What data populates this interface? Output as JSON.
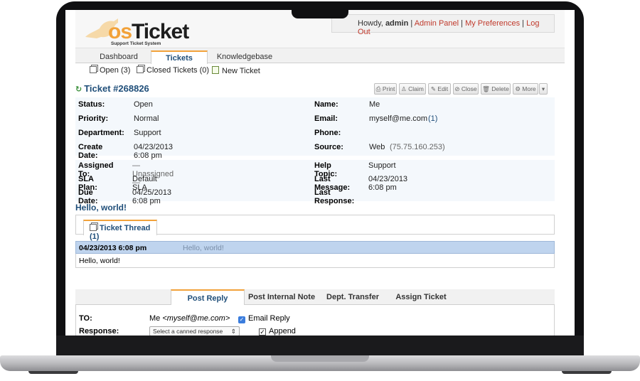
{
  "user_bar": {
    "greeting": "Howdy,",
    "username": "admin",
    "sep": "|",
    "admin_panel": "Admin Panel",
    "preferences": "My Preferences",
    "logout": "Log Out"
  },
  "logo": {
    "os": "os",
    "ticket": "Ticket",
    "subtitle": "Support Ticket System",
    "colors": {
      "accent": "#f2a23a",
      "text": "#1e1e1e"
    }
  },
  "nav": {
    "tabs": [
      {
        "label": "Dashboard"
      },
      {
        "label": "Tickets"
      },
      {
        "label": "Knowledgebase"
      }
    ],
    "active": "Tickets"
  },
  "subnav": {
    "open": "Open (3)",
    "closed": "Closed Tickets (0)",
    "new_ticket": "New Ticket"
  },
  "ticket": {
    "title": "Ticket #268826",
    "actions": [
      "Print",
      "Claim",
      "Edit",
      "Close",
      "Delete",
      "More"
    ],
    "left_fields": [
      {
        "label": "Status:",
        "value": "Open"
      },
      {
        "label": "Priority:",
        "value": "Normal"
      },
      {
        "label": "Department:",
        "value": "Support"
      },
      {
        "label": "Create Date:",
        "value": "04/23/2013 6:08 pm"
      }
    ],
    "right_fields": [
      {
        "label": "Name:",
        "value": "Me"
      },
      {
        "label": "Email:",
        "value": "myself@me.com",
        "extra": "(1)"
      },
      {
        "label": "Phone:",
        "value": ""
      },
      {
        "label": "Source:",
        "value": "Web",
        "extra": "(75.75.160.253)"
      }
    ],
    "left_fields_2": [
      {
        "label": "Assigned To:",
        "value": "— Unassigned —"
      },
      {
        "label": "SLA Plan:",
        "value": "Default SLA"
      },
      {
        "label": "Due Date:",
        "value": "04/25/2013 6:08 pm"
      }
    ],
    "right_fields_2": [
      {
        "label": "Help Topic:",
        "value": "Support"
      },
      {
        "label": "Last Message:",
        "value": "04/23/2013 6:08 pm"
      },
      {
        "label": "Last Response:",
        "value": ""
      }
    ],
    "subject": "Hello, world!"
  },
  "thread": {
    "tab_label": "Ticket Thread (1)",
    "entry": {
      "date": "04/23/2013 6:08 pm",
      "title": "Hello, world!",
      "body": "Hello, world!"
    }
  },
  "reply": {
    "tabs": [
      "Post Reply",
      "Post Internal Note",
      "Dept. Transfer",
      "Assign Ticket"
    ],
    "to_label": "TO:",
    "to_name": "Me",
    "to_email": "<myself@me.com>",
    "email_reply": "Email Reply",
    "response_label": "Response:",
    "canned_placeholder": "Select a canned response",
    "append": "Append"
  }
}
